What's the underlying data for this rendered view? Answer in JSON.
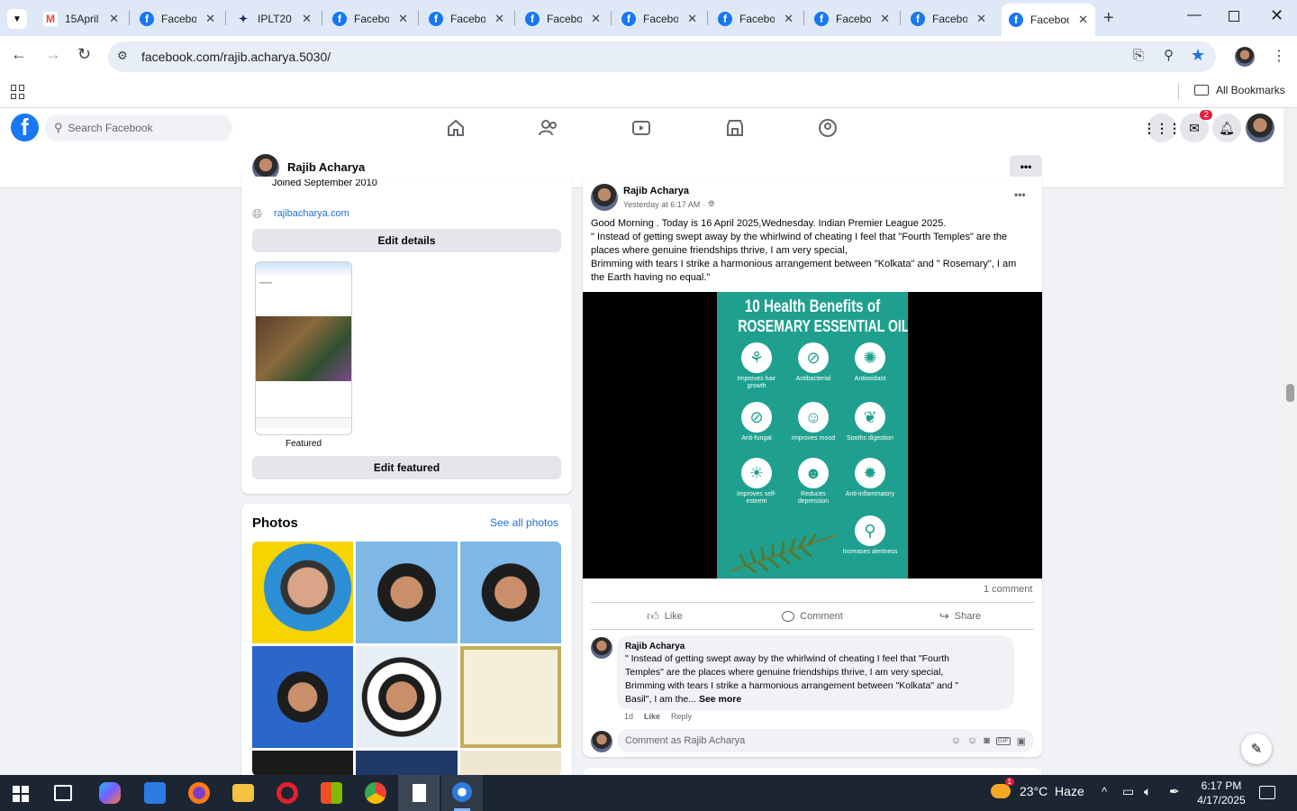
{
  "browser": {
    "tabs": [
      {
        "label": "15April",
        "icon": "gmail-icon"
      },
      {
        "label": "Facebook",
        "icon": "facebook-icon"
      },
      {
        "label": "IPLT20",
        "icon": "iplt20-icon"
      },
      {
        "label": "Facebook",
        "icon": "facebook-icon"
      },
      {
        "label": "Facebook",
        "icon": "facebook-icon"
      },
      {
        "label": "Facebook",
        "icon": "facebook-icon"
      },
      {
        "label": "Facebook",
        "icon": "facebook-icon"
      },
      {
        "label": "Facebook",
        "icon": "facebook-icon"
      },
      {
        "label": "Facebook",
        "icon": "facebook-icon"
      },
      {
        "label": "Facebook",
        "icon": "facebook-icon"
      },
      {
        "label": "Facebook",
        "icon": "facebook-icon",
        "active": true
      }
    ],
    "url": "facebook.com/rajib.acharya.5030/",
    "bookmarks_label": "All Bookmarks"
  },
  "facebook": {
    "search_placeholder": "Search Facebook",
    "messenger_badge": "2",
    "profile_name": "Rajib Acharya",
    "intro": {
      "partial_line": "Joined September 2010",
      "website": "rajibacharya.com",
      "edit_details": "Edit details",
      "featured_label": "Featured",
      "edit_featured": "Edit featured"
    },
    "photos": {
      "title": "Photos",
      "see_all": "See all photos"
    },
    "post": {
      "author": "Rajib Acharya",
      "time": "Yesterday at 6:17 AM",
      "line1": "Good Morning . Today is 16 April 2025,Wednesday. Indian Premier League 2025.",
      "line2": " \" Instead of getting swept away by the whirlwind of cheating I feel that \"Fourth Temples\" are the",
      "line3": "places where genuine friendships thrive, I am very special,",
      "line4": "Brimming with tears I strike a harmonious arrangement between \"Kolkata\" and \" Rosemary\", I am",
      "line5": "the Earth having no equal.\"",
      "image": {
        "title1": "10 Health Benefits of",
        "title2": "ROSEMARY ESSENTIAL OIL",
        "benefits": [
          "Improves hair growth",
          "Antibacterial",
          "Antioxidant",
          "Anti-fungal",
          "Improves mood",
          "Sooths digestion",
          "Improves self-esteem",
          "Reduces depression",
          "Anti-inflammatory",
          "Increases alertness"
        ],
        "bg_color": "#1fa08f"
      },
      "comment_count": "1 comment",
      "like": "Like",
      "comment": "Comment",
      "share": "Share",
      "top_comment": {
        "author": "Rajib Acharya",
        "line1": " \" Instead of getting swept away by the whirlwind of cheating I feel that \"Fourth",
        "line2": "Temples\" are the places where genuine friendships thrive, I am very special,",
        "line3": "Brimming with tears I strike a harmonious arrangement between \"Kolkata\" and \"",
        "line4": "Basil\", I am the...",
        "see_more": "See more",
        "age": "1d",
        "like": "Like",
        "reply": "Reply"
      },
      "comment_placeholder": "Comment as Rajib Acharya"
    }
  },
  "taskbar": {
    "weather": "23°C  Haze",
    "weather_badge": "1",
    "time": "6:17 PM",
    "date": "4/17/2025"
  },
  "colors": {
    "fb_blue": "#1877f2",
    "link_blue": "#216fdb",
    "tabstrip": "#dfe8f6"
  }
}
